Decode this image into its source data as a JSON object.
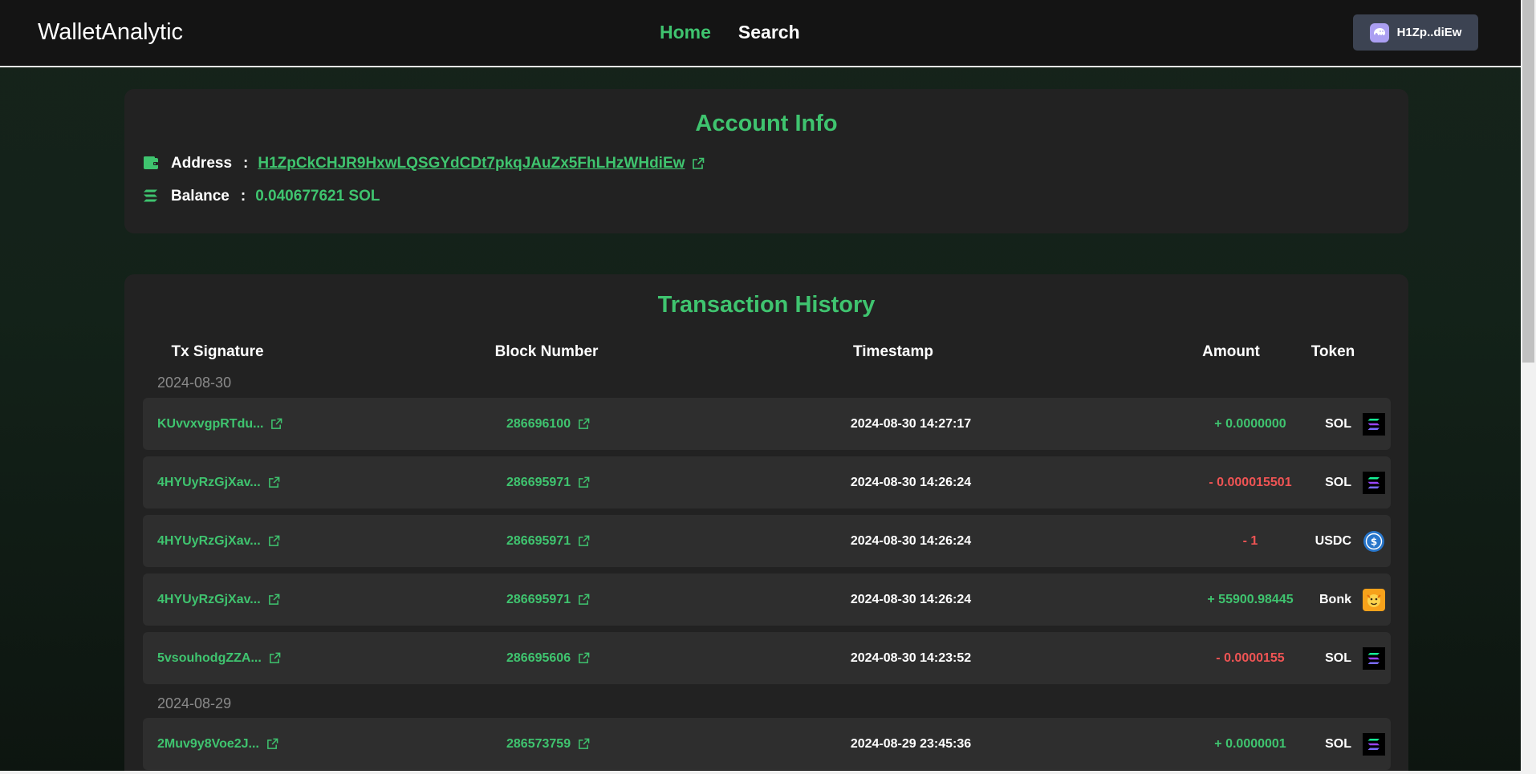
{
  "app": {
    "brand": "WalletAnalytic",
    "nav": [
      {
        "label": "Home",
        "active": true
      },
      {
        "label": "Search",
        "active": false
      }
    ],
    "wallet_button": "H1Zp..diEw"
  },
  "account": {
    "title": "Account Info",
    "address_label": "Address",
    "address": "H1ZpCkCHJR9HxwLQSGYdCDt7pkqJAuZx5FhLHzWHdiEw",
    "balance_label": "Balance",
    "balance": "0.040677621 SOL",
    "separator": ":"
  },
  "history": {
    "title": "Transaction History",
    "columns": [
      "Tx Signature",
      "Block Number",
      "Timestamp",
      "Amount",
      "Token"
    ],
    "groups": [
      {
        "date": "2024-08-30",
        "rows": [
          {
            "sig": "KUvvxvgpRTdu...",
            "block": "286696100",
            "ts": "2024-08-30 14:27:17",
            "amount": "+ 0.0000000",
            "token": "SOL",
            "icon": "solana-icon"
          },
          {
            "sig": "4HYUyRzGjXav...",
            "block": "286695971",
            "ts": "2024-08-30 14:26:24",
            "amount": "- 0.000015501",
            "token": "SOL",
            "icon": "solana-icon"
          },
          {
            "sig": "4HYUyRzGjXav...",
            "block": "286695971",
            "ts": "2024-08-30 14:26:24",
            "amount": "- 1",
            "token": "USDC",
            "icon": "usdc-icon"
          },
          {
            "sig": "4HYUyRzGjXav...",
            "block": "286695971",
            "ts": "2024-08-30 14:26:24",
            "amount": "+ 55900.98445",
            "token": "Bonk",
            "icon": "bonk-icon"
          },
          {
            "sig": "5vsouhodgZZA...",
            "block": "286695606",
            "ts": "2024-08-30 14:23:52",
            "amount": "- 0.0000155",
            "token": "SOL",
            "icon": "solana-icon"
          }
        ]
      },
      {
        "date": "2024-08-29",
        "rows": [
          {
            "sig": "2Muv9y8Voe2J...",
            "block": "286573759",
            "ts": "2024-08-29 23:45:36",
            "amount": "+ 0.0000001",
            "token": "SOL",
            "icon": "solana-icon"
          }
        ]
      }
    ]
  },
  "colors": {
    "accent": "#3fc46f",
    "negative": "#f05454",
    "card": "#222222",
    "row": "#2e2e2e"
  }
}
